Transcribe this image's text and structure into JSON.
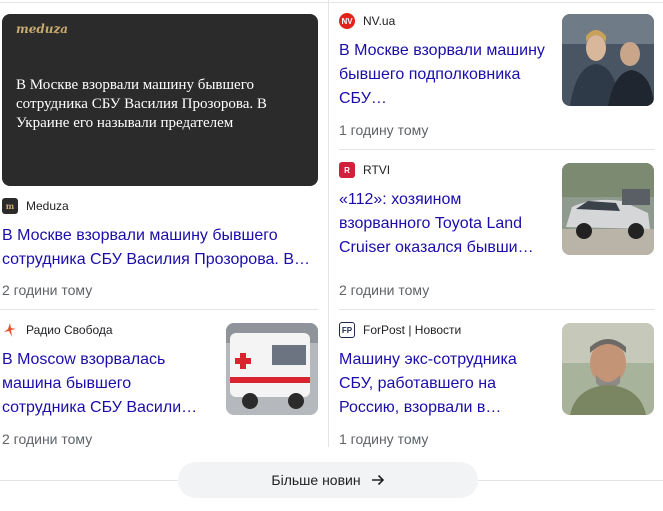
{
  "cards": [
    {
      "source": "Meduza",
      "title": "В Москве взорвали машину бывшего сотрудника СБУ Василия Прозорова. В…",
      "time": "2 години тому",
      "hero_brand": "meduza",
      "hero_text": "В Москве взорвали машину бывшего сотрудника СБУ Василия Прозорова. В Украине его называли предателем"
    },
    {
      "source": "Радио Свобода",
      "title": "В Moscow взорвалась машина бывшего сотрудника СБУ Васили…",
      "time": "2 години тому"
    },
    {
      "source": "NV.ua",
      "icon_text": "NV",
      "title": "В Москве взорвали машину бывшего подполковника СБУ…",
      "time": "1 годину тому"
    },
    {
      "source": "RTVI",
      "icon_text": "R",
      "title": "«112»: хозяином взорванного Toyota Land Cruiser оказался бывши…",
      "time": "2 години тому"
    },
    {
      "source": "ForPost | Новости",
      "icon_text": "FP",
      "title": "Машину экс-сотрудника СБУ, работавшего на Россию, взорвали в…",
      "time": "1 годину тому"
    }
  ],
  "more_button": "Більше новин",
  "colors": {
    "link": "#1a0dab",
    "meta": "#5f6368",
    "nv": "#e2231a",
    "rtvi": "#d21f3c",
    "svoboda": "#e8512a"
  }
}
